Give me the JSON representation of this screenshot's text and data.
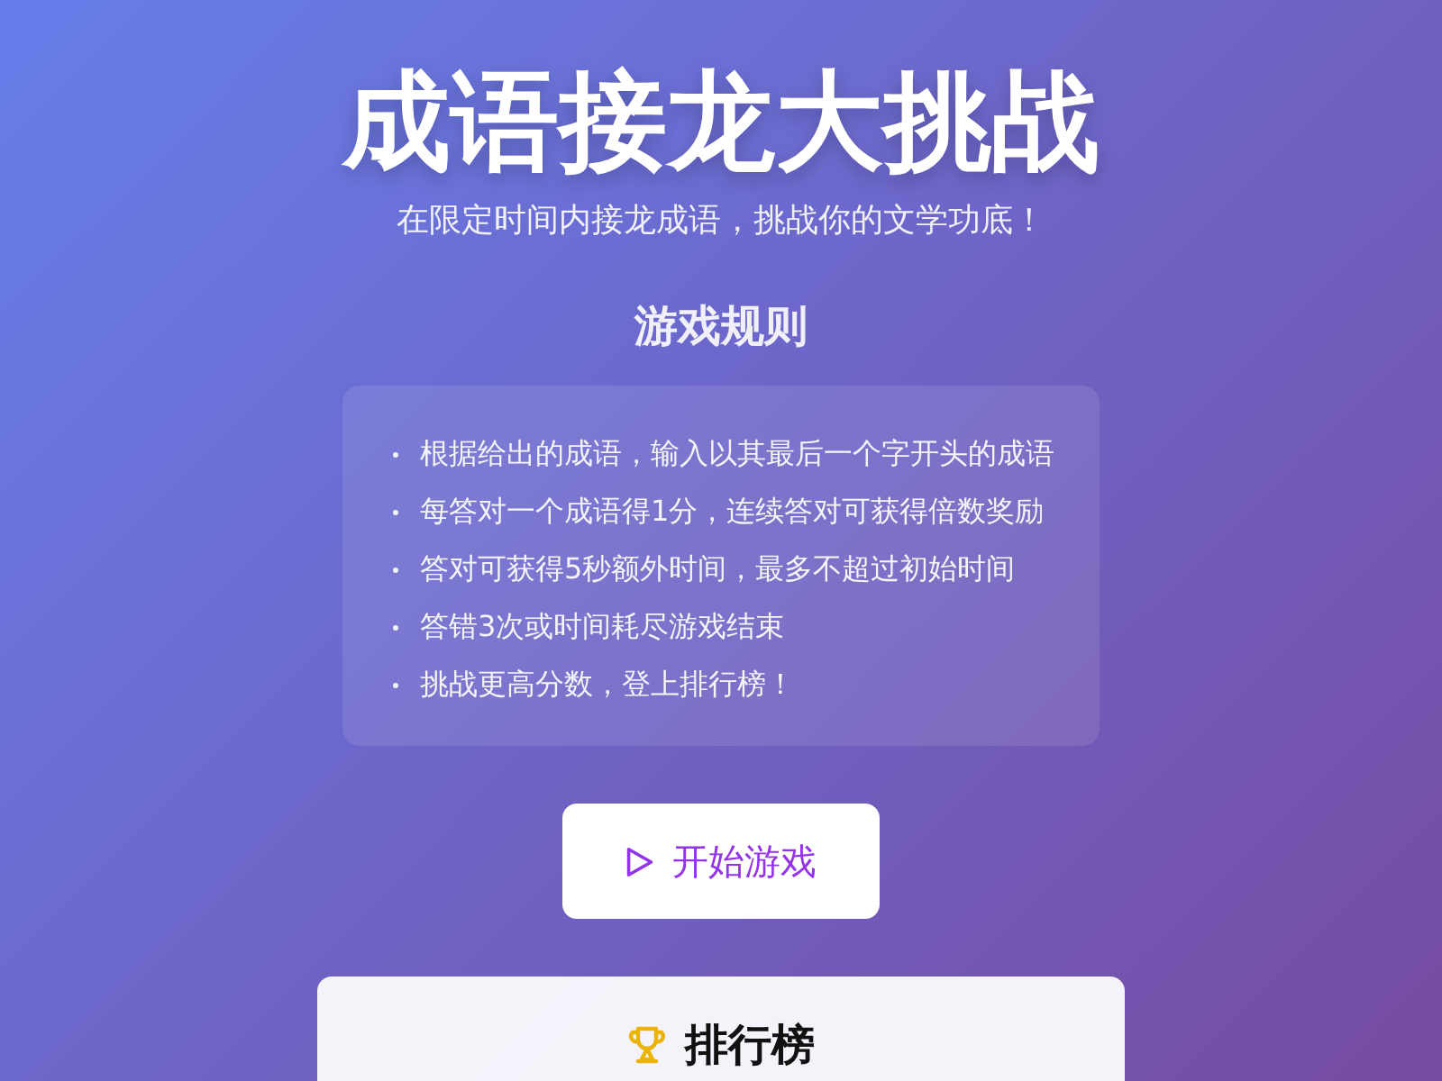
{
  "title": "成语接龙大挑战",
  "subtitle": "在限定时间内接龙成语，挑战你的文学功底！",
  "rules": {
    "heading": "游戏规则",
    "items": [
      "根据给出的成语，输入以其最后一个字开头的成语",
      "每答对一个成语得1分，连续答对可获得倍数奖励",
      "答对可获得5秒额外时间，最多不超过初始时间",
      "答错3次或时间耗尽游戏结束",
      "挑战更高分数，登上排行榜！"
    ]
  },
  "start_button": {
    "label": "开始游戏"
  },
  "leaderboard": {
    "heading": "排行榜"
  }
}
